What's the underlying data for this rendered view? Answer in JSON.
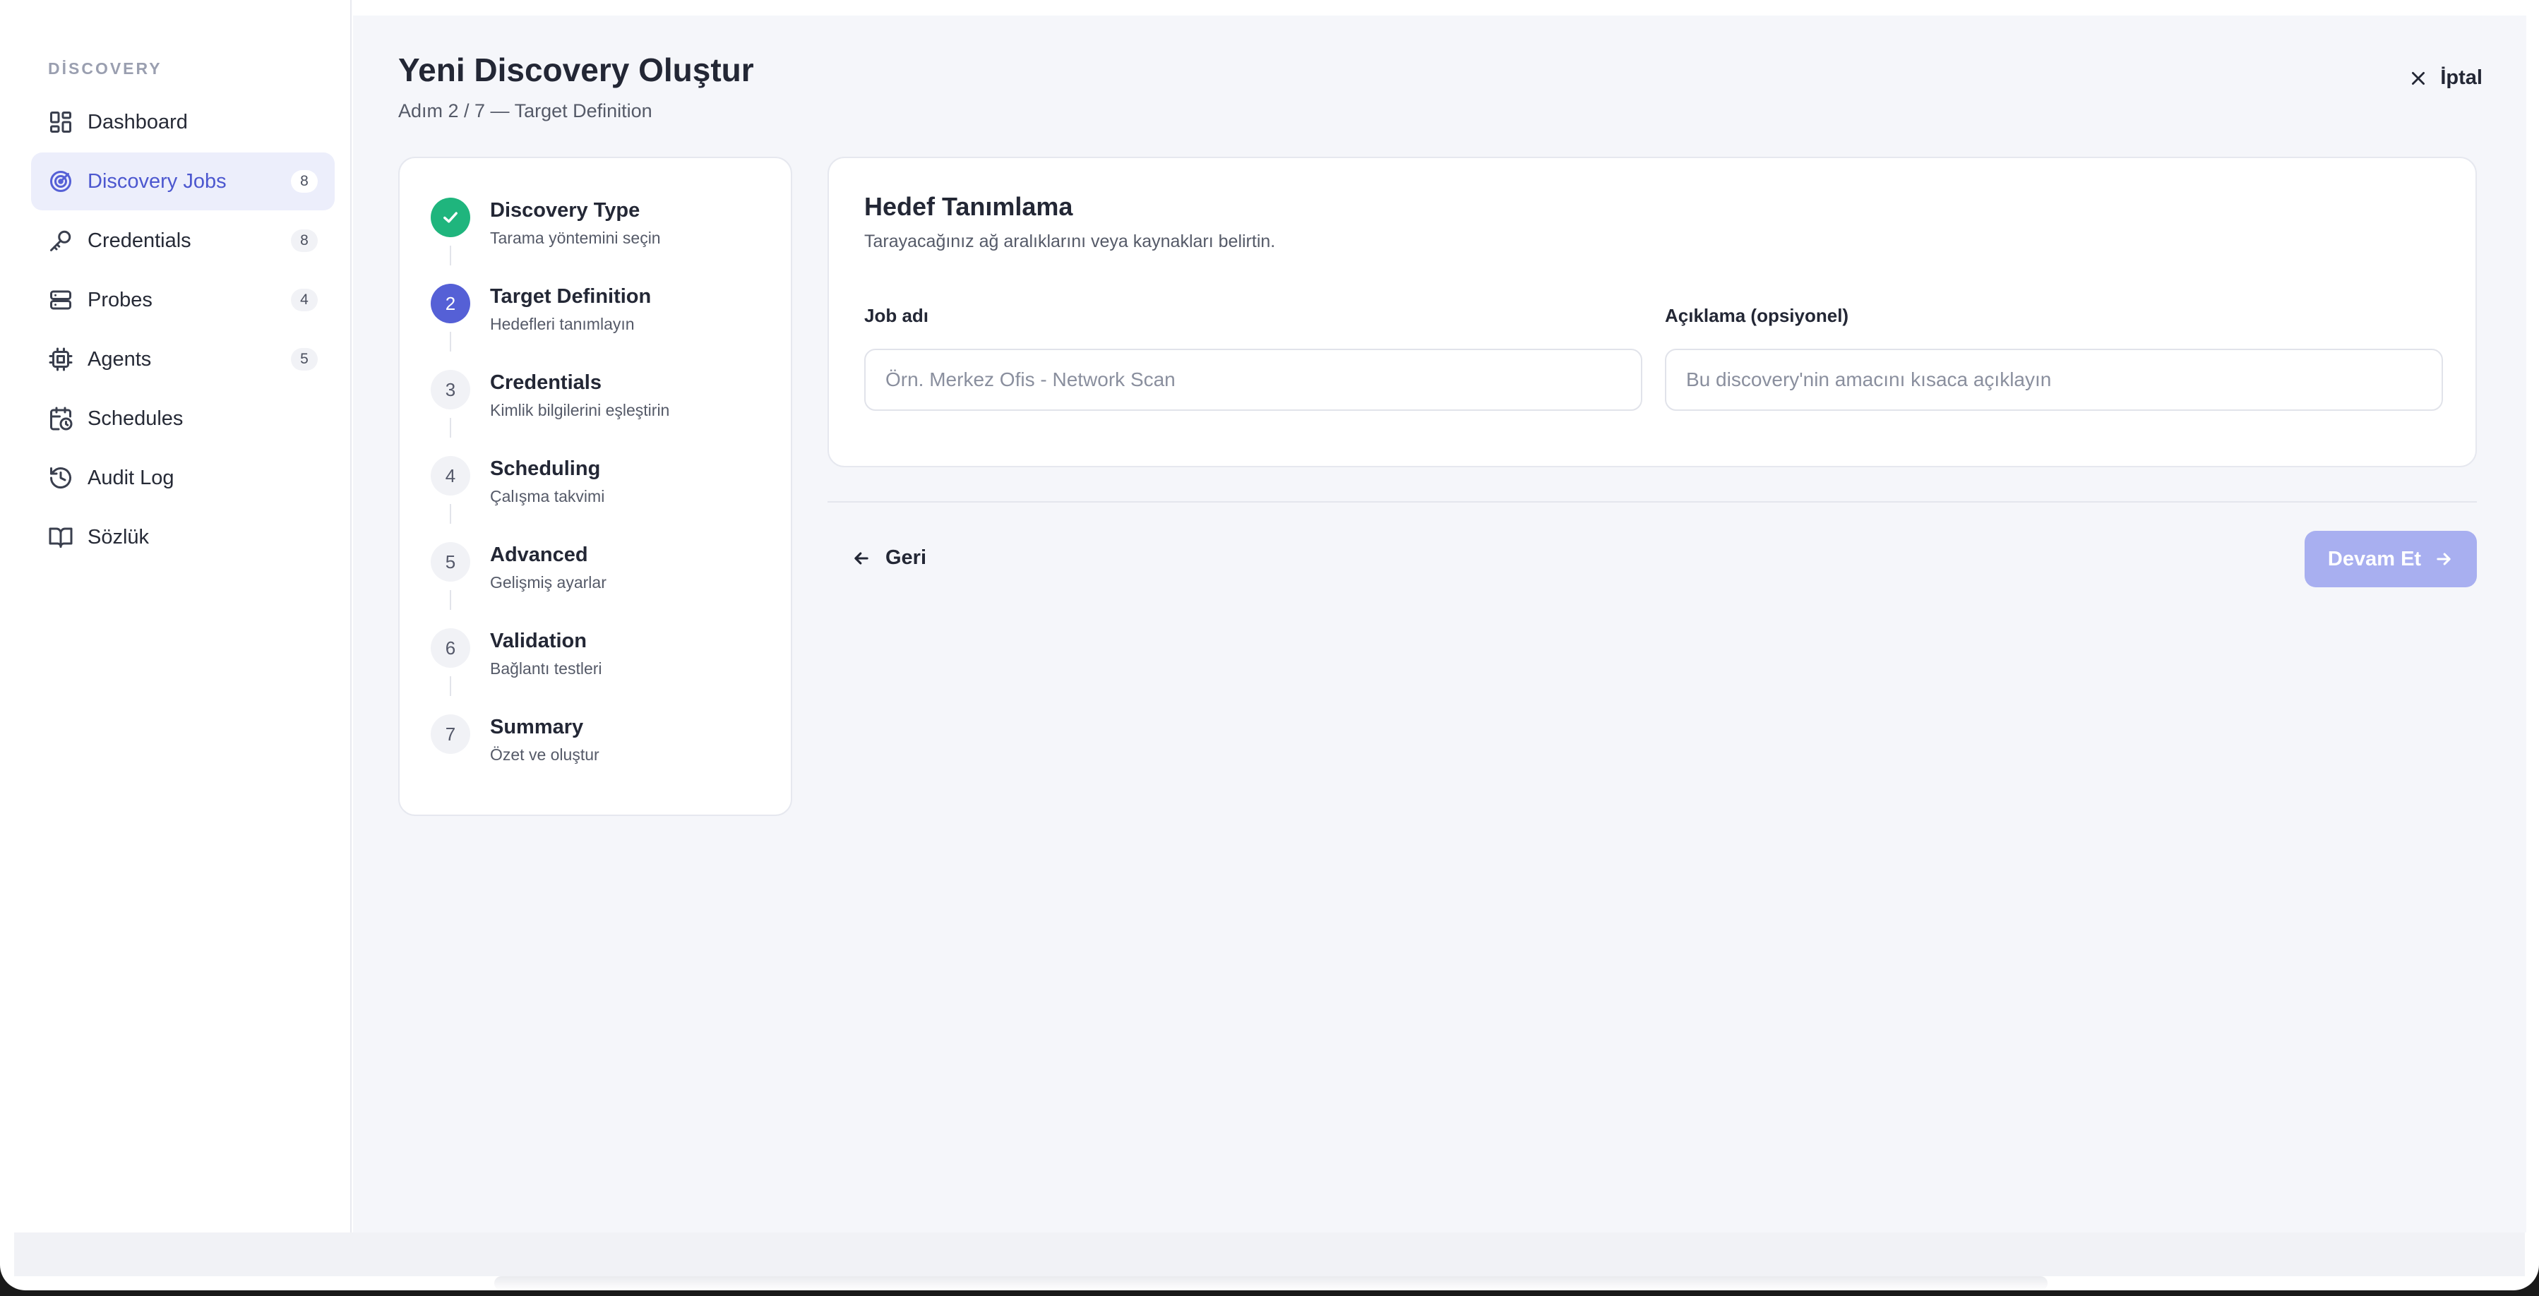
{
  "sidebar": {
    "heading": "DİSCOVERY",
    "items": [
      {
        "label": "Dashboard",
        "icon": "dashboard-icon",
        "count": null,
        "active": false
      },
      {
        "label": "Discovery Jobs",
        "icon": "radar-icon",
        "count": "8",
        "active": true
      },
      {
        "label": "Credentials",
        "icon": "key-icon",
        "count": "8",
        "active": false
      },
      {
        "label": "Probes",
        "icon": "server-icon",
        "count": "4",
        "active": false
      },
      {
        "label": "Agents",
        "icon": "cpu-icon",
        "count": "5",
        "active": false
      },
      {
        "label": "Schedules",
        "icon": "calendar-clock-icon",
        "count": null,
        "active": false
      },
      {
        "label": "Audit Log",
        "icon": "history-icon",
        "count": null,
        "active": false
      },
      {
        "label": "Sözlük",
        "icon": "book-icon",
        "count": null,
        "active": false
      }
    ]
  },
  "header": {
    "title": "Yeni Discovery Oluştur",
    "subtitle": "Adım 2 / 7 — Target Definition",
    "cancel_label": "İptal"
  },
  "steps": [
    {
      "number": "1",
      "title": "Discovery Type",
      "description": "Tarama yöntemini seçin",
      "state": "done"
    },
    {
      "number": "2",
      "title": "Target Definition",
      "description": "Hedefleri tanımlayın",
      "state": "current"
    },
    {
      "number": "3",
      "title": "Credentials",
      "description": "Kimlik bilgilerini eşleştirin",
      "state": "pending"
    },
    {
      "number": "4",
      "title": "Scheduling",
      "description": "Çalışma takvimi",
      "state": "pending"
    },
    {
      "number": "5",
      "title": "Advanced",
      "description": "Gelişmiş ayarlar",
      "state": "pending"
    },
    {
      "number": "6",
      "title": "Validation",
      "description": "Bağlantı testleri",
      "state": "pending"
    },
    {
      "number": "7",
      "title": "Summary",
      "description": "Özet ve oluştur",
      "state": "pending"
    }
  ],
  "form": {
    "title": "Hedef Tanımlama",
    "description": "Tarayacağınız ağ aralıklarını veya kaynakları belirtin.",
    "job_name": {
      "label": "Job adı",
      "value": "",
      "placeholder": "Örn. Merkez Ofis - Network Scan"
    },
    "description_field": {
      "label": "Açıklama (opsiyonel)",
      "value": "",
      "placeholder": "Bu discovery'nin amacını kısaca açıklayın"
    }
  },
  "footer": {
    "back_label": "Geri",
    "next_label": "Devam Et",
    "next_disabled": true
  },
  "colors": {
    "accent": "#5560d6",
    "success": "#1fb57d",
    "disabled_button": "#a8aff0",
    "background": "#f5f6fa"
  }
}
